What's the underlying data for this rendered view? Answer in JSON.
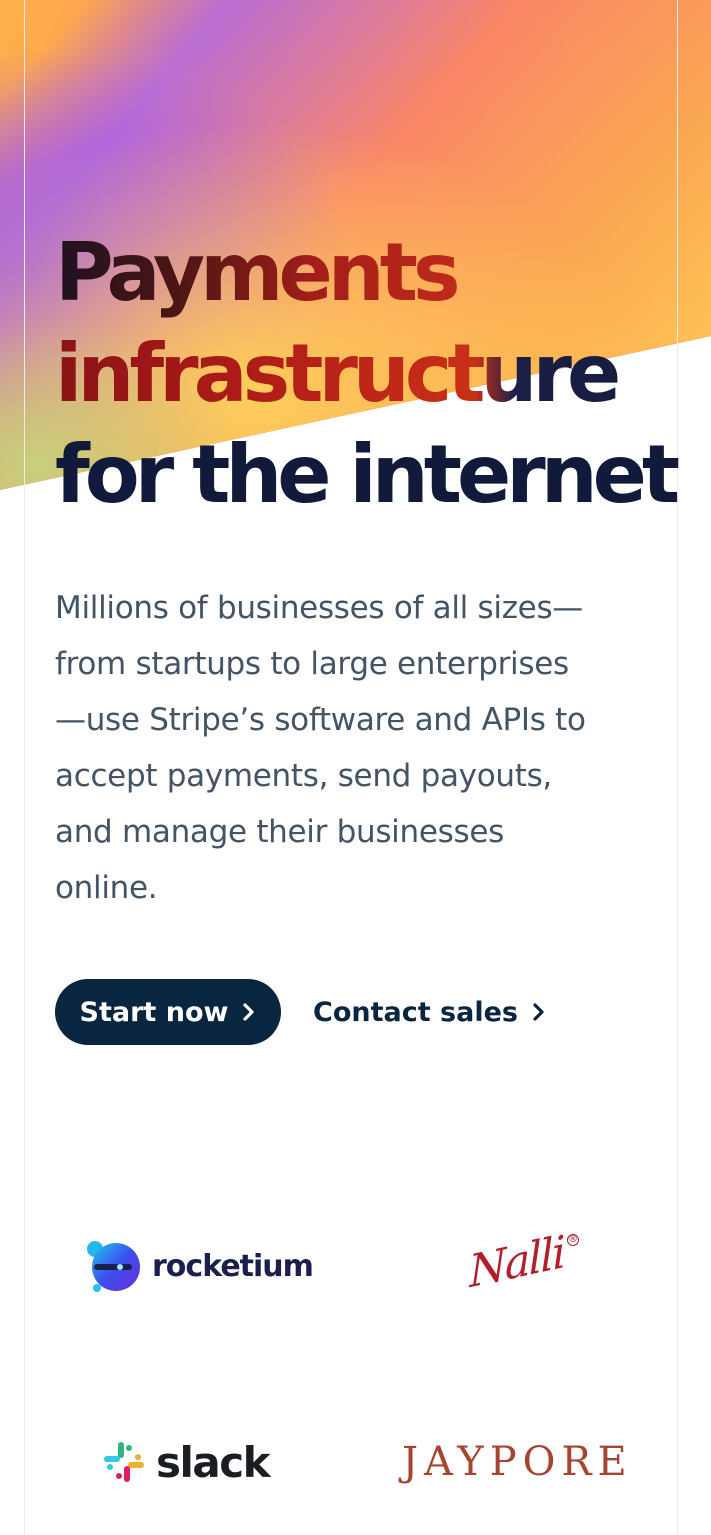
{
  "hero": {
    "headline_lines": [
      "Payments",
      "infrastructure",
      "for the internet"
    ],
    "lede": "Millions of businesses of all sizes—from startups to large enterprises—use Stripe’s software and APIs to accept payments, send payouts, and manage their businesses online.",
    "lede_lines": [
      "Millions of businesses of all sizes—",
      "from startups to large enterprises",
      "—use Stripe’s software and APIs to",
      "accept payments, send payouts,",
      "and manage their businesses",
      "online."
    ],
    "gradient_colors": [
      "#ffb14a",
      "#a960ee",
      "#ff6a3d",
      "#b300ff",
      "#ffcb57"
    ]
  },
  "actions": {
    "primary_label": "Start now",
    "secondary_label": "Contact sales",
    "chevron_icon": "chevron-right-icon",
    "primary_color": "#0a2540"
  },
  "logos": {
    "rocketium": "rocketium",
    "nalli": "Nalli",
    "slack": "slack",
    "jaypore": "JAYPORE"
  }
}
